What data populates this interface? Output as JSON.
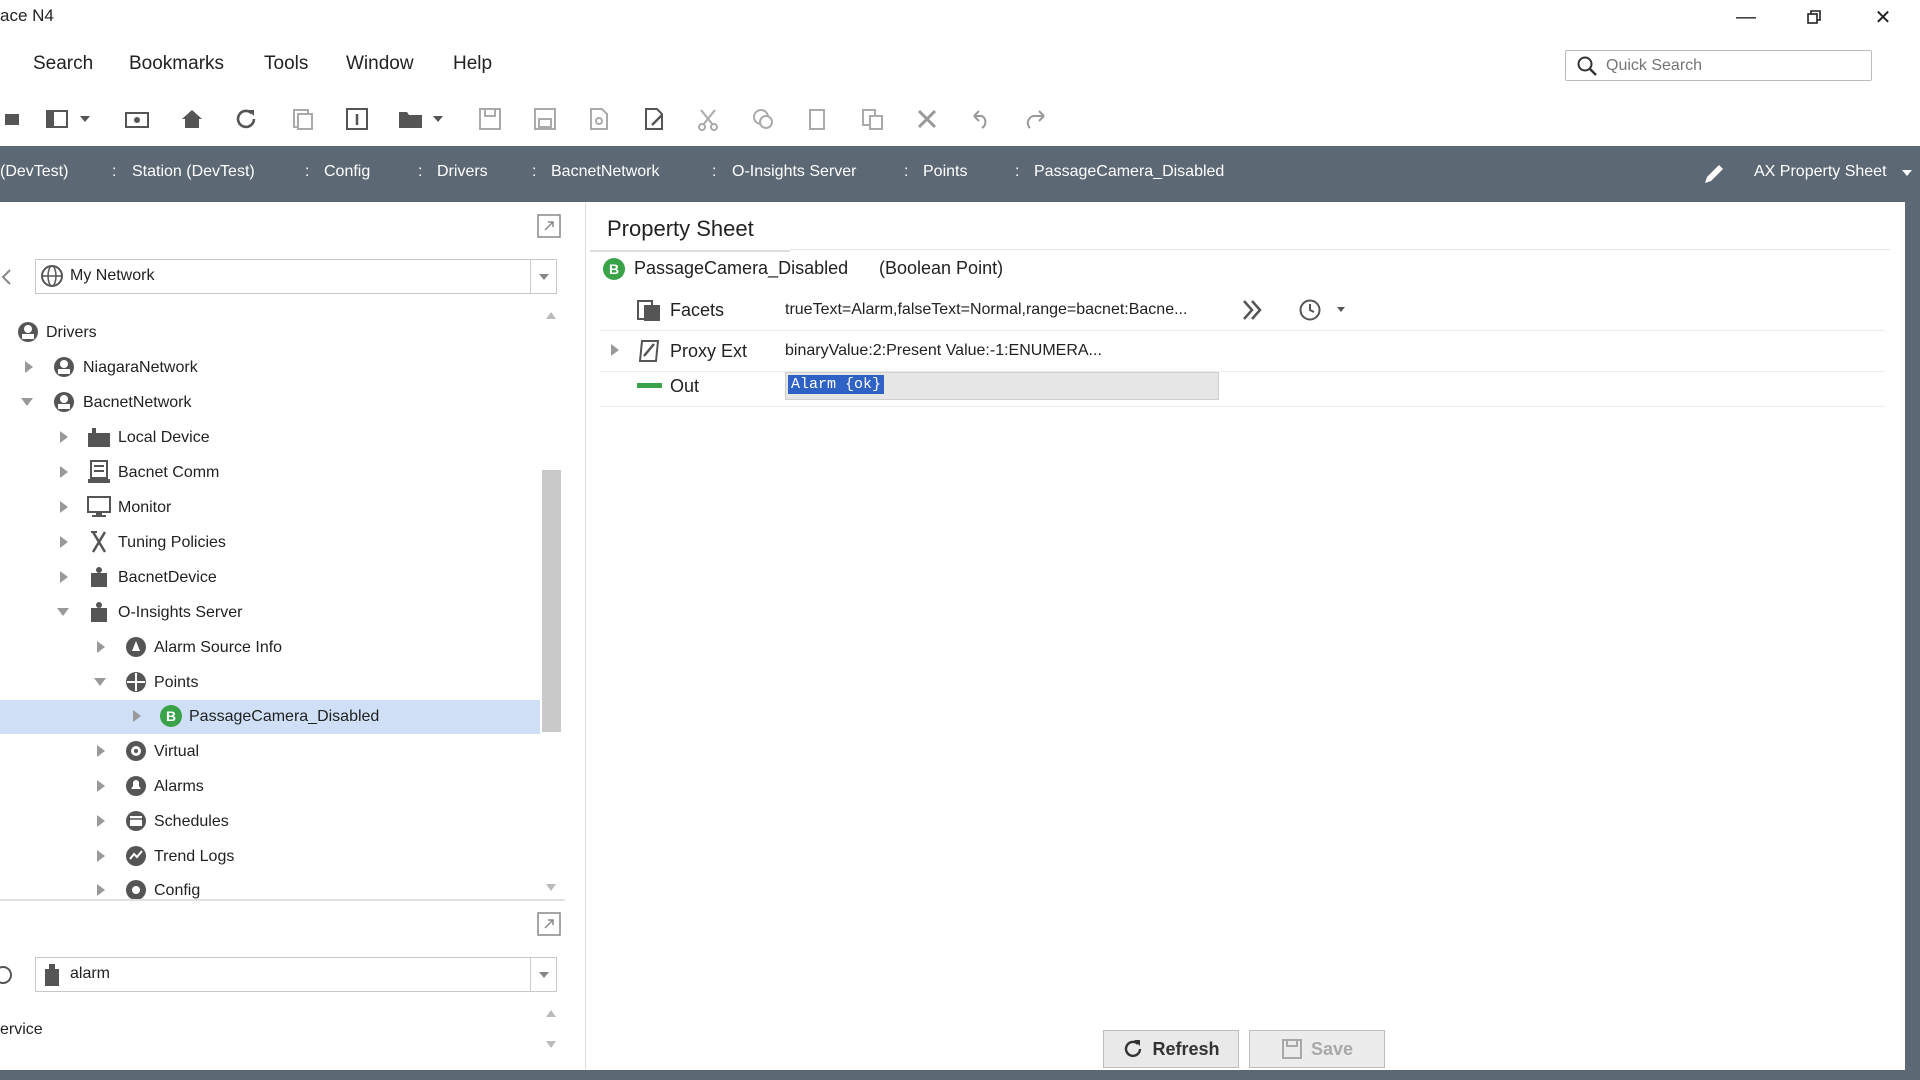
{
  "window": {
    "title": "ace N4"
  },
  "menu": [
    "Search",
    "Bookmarks",
    "Tools",
    "Window",
    "Help"
  ],
  "quick_search": {
    "placeholder": "Quick Search"
  },
  "breadcrumb": [
    "(DevTest)",
    "Station (DevTest)",
    "Config",
    "Drivers",
    "BacnetNetwork",
    "O-Insights Server",
    "Points",
    "PassageCamera_Disabled"
  ],
  "view_selector": {
    "label": "AX Property Sheet"
  },
  "nav": {
    "selector_value": "My Network",
    "tree": [
      {
        "label": "Drivers"
      },
      {
        "label": "NiagaraNetwork"
      },
      {
        "label": "BacnetNetwork"
      },
      {
        "label": "Local Device"
      },
      {
        "label": "Bacnet Comm"
      },
      {
        "label": "Monitor"
      },
      {
        "label": "Tuning Policies"
      },
      {
        "label": "BacnetDevice"
      },
      {
        "label": "O-Insights Server"
      },
      {
        "label": "Alarm Source Info"
      },
      {
        "label": "Points"
      },
      {
        "label": "PassageCamera_Disabled"
      },
      {
        "label": "Virtual"
      },
      {
        "label": "Alarms"
      },
      {
        "label": "Schedules"
      },
      {
        "label": "Trend Logs"
      },
      {
        "label": "Config"
      }
    ]
  },
  "palette": {
    "selector_value": "alarm",
    "item": "ervice"
  },
  "property_sheet": {
    "tab": "Property Sheet",
    "header_name": "PassageCamera_Disabled",
    "header_type": "(Boolean Point)",
    "rows": [
      {
        "name": "Facets",
        "value": "trueText=Alarm,falseText=Normal,range=bacnet:Bacne..."
      },
      {
        "name": "Proxy Ext",
        "value": "binaryValue:2:Present Value:-1:ENUMERA..."
      },
      {
        "name": "Out",
        "value": "Alarm {ok}"
      }
    ]
  },
  "buttons": {
    "refresh": "Refresh",
    "save": "Save"
  },
  "colors": {
    "breadcrumb_bg": "#5c6873",
    "selection": "#cfe0f6",
    "boolean_badge": "#3aa34a"
  }
}
